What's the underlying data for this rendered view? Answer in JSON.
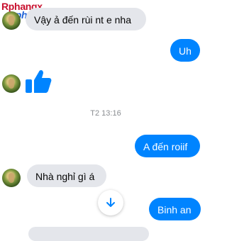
{
  "watermark": {
    "line1": "Rphangx",
    "line2": "Rphang"
  },
  "messages": [
    {
      "side": "in",
      "text": "Vậy ả đến rùi nt e nha"
    },
    {
      "side": "out",
      "text": "Uh"
    },
    {
      "side": "in",
      "text": "",
      "kind": "like-icon"
    },
    {
      "side": "out",
      "text": "A đến roiif"
    },
    {
      "side": "in",
      "text": "Nhà nghỉ gì á"
    },
    {
      "side": "out",
      "text": "Binh an"
    }
  ],
  "timestamp": "T2 13:16",
  "colors": {
    "outgoing": "#0084ff",
    "incoming": "#e4e6eb",
    "like": "#0084ff"
  },
  "icons": {
    "like": "thumbs-up-icon",
    "scroll": "arrow-down-icon"
  }
}
